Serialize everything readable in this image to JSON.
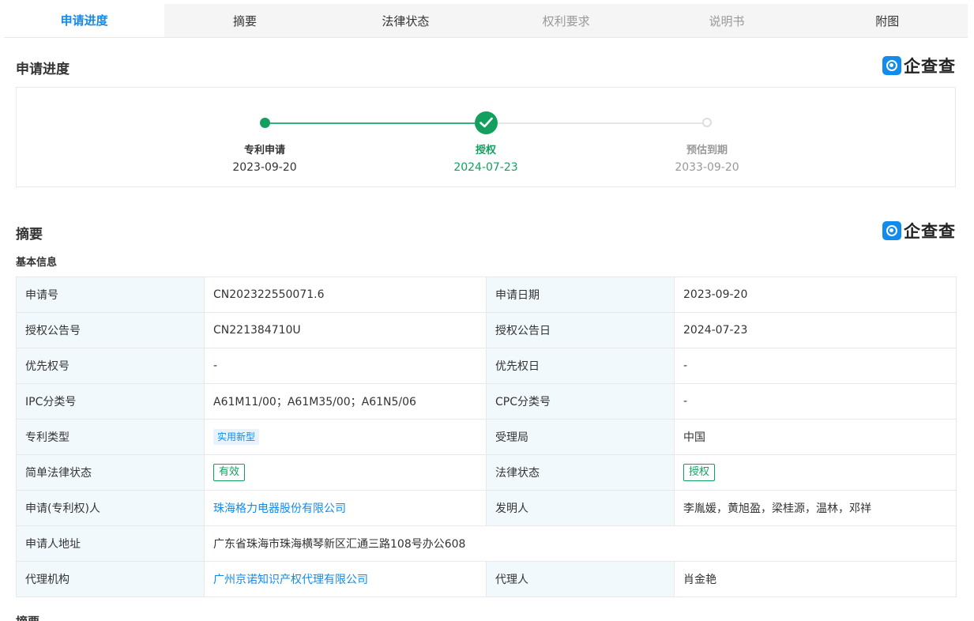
{
  "tabs": [
    {
      "label": "申请进度"
    },
    {
      "label": "摘要"
    },
    {
      "label": "法律状态"
    },
    {
      "label": "权利要求"
    },
    {
      "label": "说明书"
    },
    {
      "label": "附图"
    }
  ],
  "brand": {
    "name": "企查查",
    "color": "#128bed"
  },
  "progress": {
    "title": "申请进度",
    "steps": [
      {
        "label": "专利申请",
        "date": "2023-09-20"
      },
      {
        "label": "授权",
        "date": "2024-07-23"
      },
      {
        "label": "预估到期",
        "date": "2033-09-20"
      }
    ]
  },
  "abstract": {
    "title": "摘要",
    "basic_info_title": "基本信息",
    "rows": [
      [
        {
          "k": "申请号",
          "v": "CN202322550071.6"
        },
        {
          "k": "申请日期",
          "v": "2023-09-20"
        }
      ],
      [
        {
          "k": "授权公告号",
          "v": "CN221384710U"
        },
        {
          "k": "授权公告日",
          "v": "2024-07-23"
        }
      ],
      [
        {
          "k": "优先权号",
          "v": "-"
        },
        {
          "k": "优先权日",
          "v": "-"
        }
      ],
      [
        {
          "k": "IPC分类号",
          "v": "A61M11/00；A61M35/00；A61N5/06"
        },
        {
          "k": "CPC分类号",
          "v": "-"
        }
      ],
      [
        {
          "k": "专利类型",
          "v": "实用新型"
        },
        {
          "k": "受理局",
          "v": "中国"
        }
      ],
      [
        {
          "k": "简单法律状态",
          "v": "有效"
        },
        {
          "k": "法律状态",
          "v": "授权"
        }
      ],
      [
        {
          "k": "申请(专利权)人",
          "v": "珠海格力电器股份有限公司"
        },
        {
          "k": "发明人",
          "v": "李胤媛，黄旭盈，梁桂源，温林，邓祥"
        }
      ],
      [
        {
          "k": "申请人地址",
          "v": "广东省珠海市珠海横琴新区汇通三路108号办公608"
        }
      ],
      [
        {
          "k": "代理机构",
          "v": "广州京诺知识产权代理有限公司"
        },
        {
          "k": "代理人",
          "v": "肖金艳"
        }
      ]
    ],
    "next_section_label": "摘要"
  }
}
